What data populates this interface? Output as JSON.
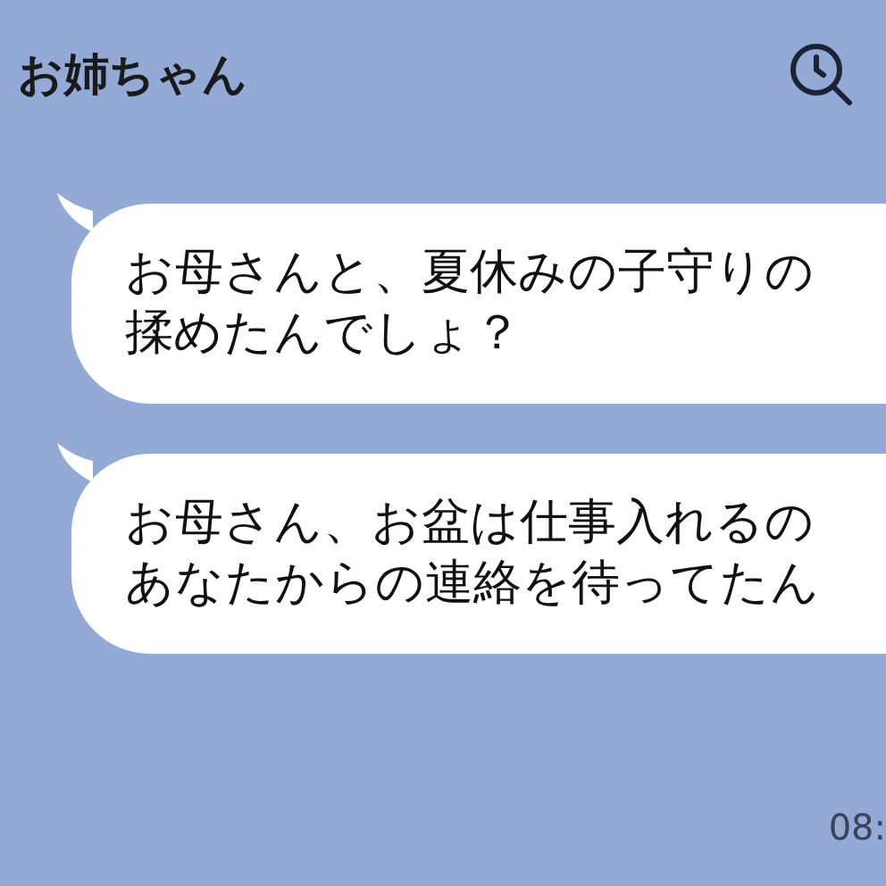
{
  "header": {
    "title": "お姉ちゃん"
  },
  "messages": [
    {
      "lines": [
        "お母さんと、夏休みの子守りの",
        "揉めたんでしょ？"
      ]
    },
    {
      "lines": [
        "お母さん、お盆は仕事入れるの",
        "あなたからの連絡を待ってたん"
      ]
    }
  ],
  "time": "08:"
}
